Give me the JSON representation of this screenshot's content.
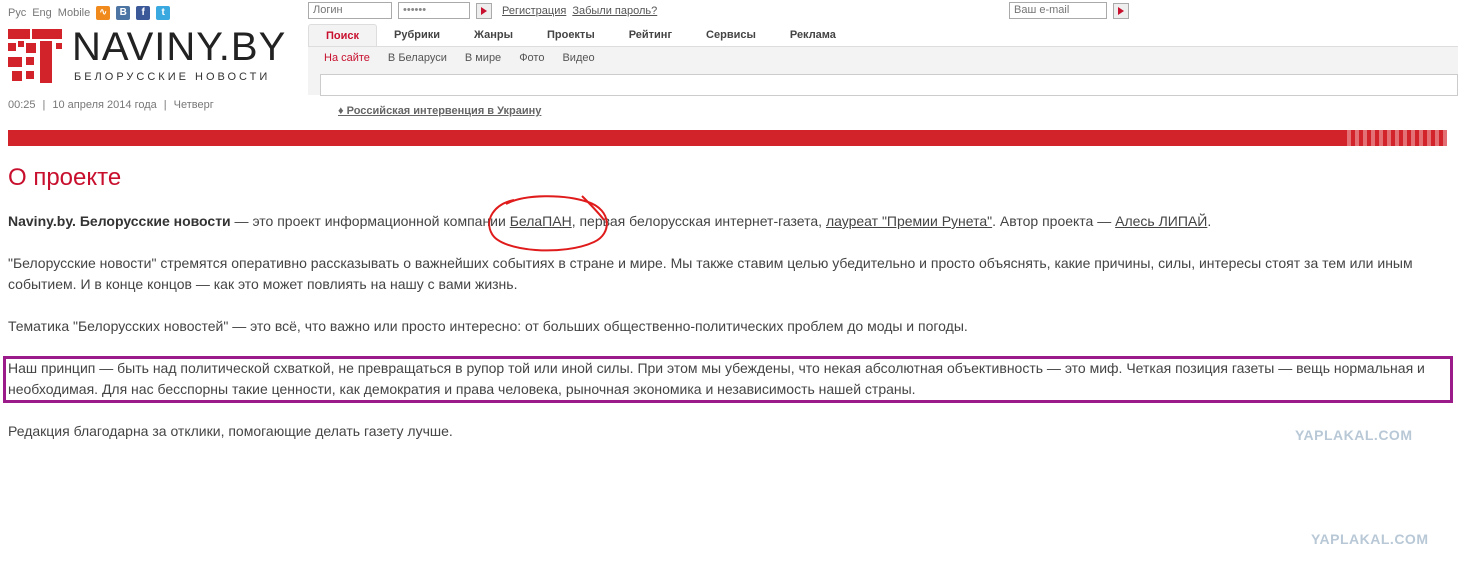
{
  "top_links": {
    "rus": "Рус",
    "eng": "Eng",
    "mobile": "Mobile"
  },
  "social": {
    "rss": "rss-icon",
    "vk": "vkontakte-icon",
    "fb": "facebook-icon",
    "tw": "twitter-icon"
  },
  "logo": {
    "title": "NAVINY.BY",
    "subtitle": "БЕЛОРУССКИЕ НОВОСТИ"
  },
  "dateline": {
    "time": "00:25",
    "date": "10 апреля 2014 года",
    "weekday": "Четверг"
  },
  "login": {
    "login_placeholder": "Логин",
    "password_value": "••••••",
    "register": "Регистрация",
    "forgot": "Забыли пароль?"
  },
  "email": {
    "placeholder": "Ваш e-mail"
  },
  "nav": {
    "items": [
      "Поиск",
      "Рубрики",
      "Жанры",
      "Проекты",
      "Рейтинг",
      "Сервисы",
      "Реклама"
    ],
    "sub": [
      "На сайте",
      "В Беларуси",
      "В мире",
      "Фото",
      "Видео"
    ]
  },
  "special_link": "♦ Российская интервенция в Украину",
  "content": {
    "title": "О проекте",
    "p1": {
      "b": "Naviny.by. Белорусские новости",
      "t1": " — это проект информационной компании ",
      "link1": "БелаПАН",
      "t2": ", первая белорусская интернет-газета, ",
      "link2": "лауреат \"Премии Рунета\"",
      "t3": ". Автор проекта — ",
      "link3": "Алесь ЛИПАЙ",
      "t4": "."
    },
    "p2": "\"Белорусские новости\" стремятся оперативно рассказывать о важнейших событиях в стране и мире. Мы также ставим целью убедительно и просто объяснять, какие причины, силы, интересы стоят за тем или иным событием. И в конце концов — как это может повлиять на нашу с вами жизнь.",
    "p3": "Тематика \"Белорусских новостей\" — это всё, что важно или просто интересно: от больших общественно-политических проблем до моды и погоды.",
    "p4": "Наш принцип — быть над политической схваткой, не превращаться в рупор той или иной силы. При этом мы убеждены, что некая абсолютная объективность — это миф. Четкая позиция газеты — вещь нормальная и необходимая. Для нас бесспорны такие ценности, как демократия и права человека, рыночная экономика и независимость нашей страны.",
    "p5": "Редакция благодарна за отклики, помогающие делать газету лучше."
  },
  "watermark": "YAPLAKAL.COM",
  "colors": {
    "brand_red": "#d2232a",
    "highlight_purple": "#9b1b8a",
    "annotation_red": "#e01b1b"
  }
}
